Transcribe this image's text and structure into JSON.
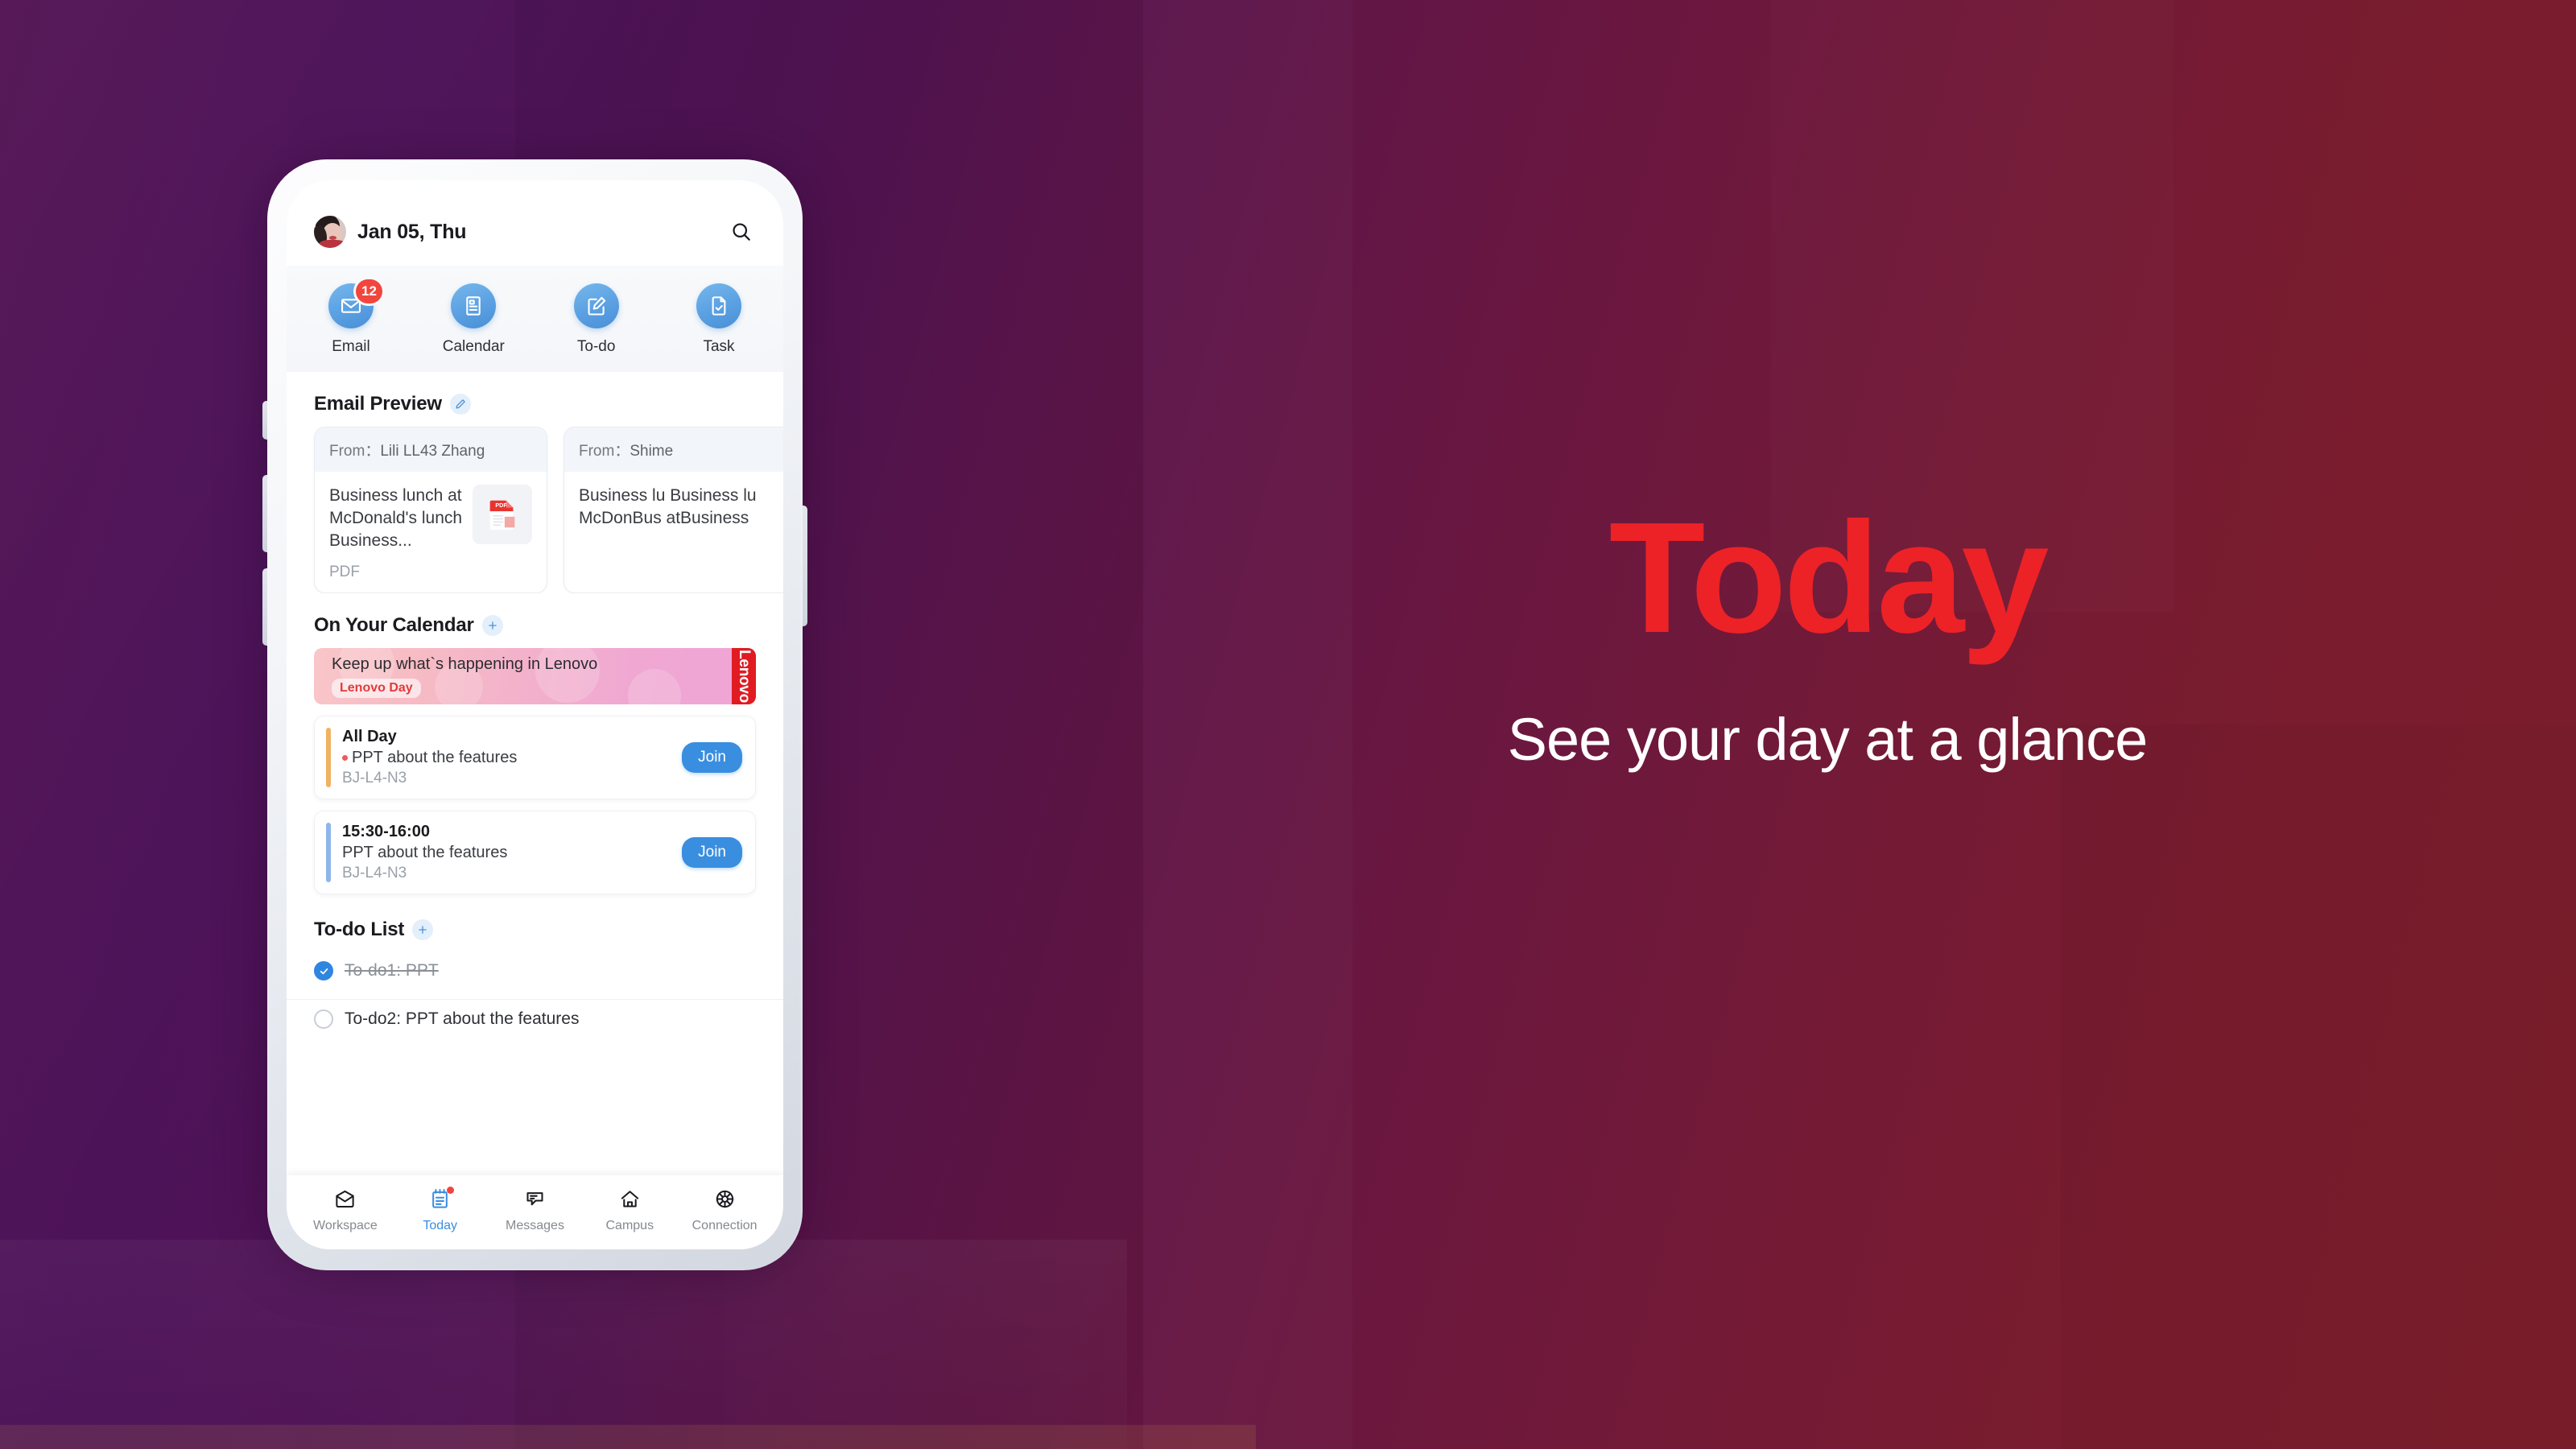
{
  "hero": {
    "title": "Today",
    "subtitle": "See your day at a glance",
    "title_color": "#ec2227",
    "subtitle_color": "#ffffff"
  },
  "background": {
    "left_color": "#521253",
    "right_color": "#7c1d2b"
  },
  "phone": {
    "header": {
      "date": "Jan 05, Thu",
      "avatar_icon": "user-avatar",
      "search_icon": "search-icon"
    },
    "quick_actions": [
      {
        "label": "Email",
        "icon": "envelope-icon",
        "badge": "12"
      },
      {
        "label": "Calendar",
        "icon": "calendar-doc-icon",
        "badge": ""
      },
      {
        "label": "To-do",
        "icon": "edit-square-icon",
        "badge": ""
      },
      {
        "label": "Task",
        "icon": "document-check-icon",
        "badge": ""
      }
    ],
    "email_preview": {
      "title": "Email Preview",
      "action_icon": "pencil-edit-icon",
      "from_label": "From：",
      "cards": [
        {
          "from": "Lili LL43 Zhang",
          "subject": "Business lunch at McDonald's lunch Business...",
          "attachment_type": "PDF",
          "thumb_icon": "pdf-file-icon"
        },
        {
          "from": "Shime",
          "subject": "Business lu Business lu McDonBus atBusiness",
          "attachment_type": "",
          "thumb_icon": ""
        }
      ]
    },
    "calendar": {
      "title": "On Your Calendar",
      "action_icon": "plus-icon",
      "banner": {
        "headline": "Keep up what`s happening in Lenovo",
        "tag": "Lenovo Day",
        "brand": "Lenovo",
        "brand_color": "#e01b22",
        "tag_color": "#e23b3b"
      },
      "events": [
        {
          "time": "All Day",
          "title": "PPT about the features",
          "room": "BJ-L4-N3",
          "join_label": "Join",
          "bar_color": "#f0b262",
          "has_dot": true
        },
        {
          "time": "15:30-16:00",
          "title": "PPT about the features",
          "room": "BJ-L4-N3",
          "join_label": "Join",
          "bar_color": "#8fb6ea",
          "has_dot": false
        }
      ]
    },
    "todo": {
      "title": "To-do List",
      "action_icon": "plus-icon",
      "items": [
        {
          "text": "To-do1: PPT",
          "done": true
        },
        {
          "text": "To-do2: PPT about the features",
          "done": false
        }
      ]
    },
    "bottom_nav": {
      "items": [
        {
          "label": "Workspace",
          "icon": "inbox-icon",
          "active": false,
          "badge": false
        },
        {
          "label": "Today",
          "icon": "notepad-icon",
          "active": true,
          "badge": true
        },
        {
          "label": "Messages",
          "icon": "chat-bubble-icon",
          "active": false,
          "badge": false
        },
        {
          "label": "Campus",
          "icon": "home-icon",
          "active": false,
          "badge": false
        },
        {
          "label": "Connection",
          "icon": "globe-web-icon",
          "active": false,
          "badge": false
        }
      ]
    }
  }
}
